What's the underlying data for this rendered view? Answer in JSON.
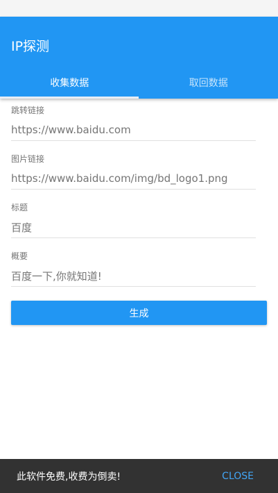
{
  "app_bar": {
    "title": "IP探测",
    "color": "#2196f3"
  },
  "tabs": [
    {
      "label": "收集数据",
      "active": true
    },
    {
      "label": "取回数据",
      "active": false
    }
  ],
  "form": {
    "fields": [
      {
        "label": "跳转链接",
        "value": "https://www.baidu.com"
      },
      {
        "label": "图片链接",
        "value": "https://www.baidu.com/img/bd_logo1.png"
      },
      {
        "label": "标题",
        "value": "百度"
      },
      {
        "label": "概要",
        "value": "百度一下,你就知道!"
      }
    ],
    "submit_label": "生成"
  },
  "snackbar": {
    "message": "此软件免费,收费为倒卖!",
    "action_label": "CLOSE"
  }
}
